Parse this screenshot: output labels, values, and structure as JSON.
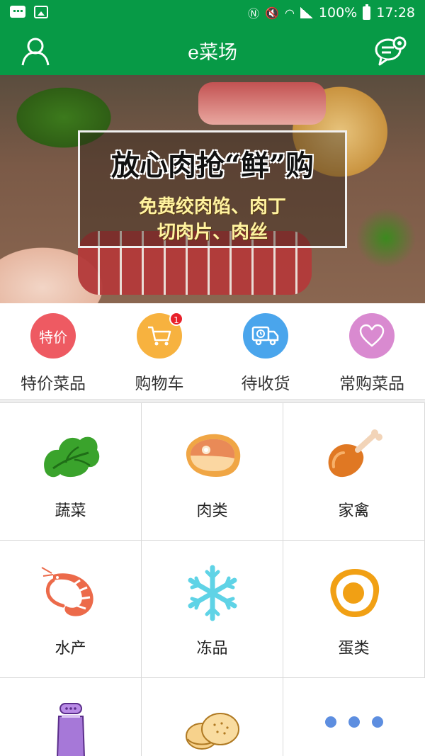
{
  "status_bar": {
    "battery": "100%",
    "time": "17:28",
    "icons": [
      "message-icon",
      "image-icon",
      "nfc-icon",
      "mute-icon",
      "wifi-icon",
      "signal-icon",
      "battery-icon"
    ]
  },
  "header": {
    "title": "e菜场",
    "left_icon": "user-icon",
    "right_icon": "chat-icon",
    "color": "#079a46"
  },
  "banner": {
    "headline": "放心肉抢“鲜”购",
    "line1": "免费绞肉馅、肉丁",
    "line2": "切肉片、肉丝",
    "page_count": 3,
    "active_page": 1
  },
  "quick_entries": [
    {
      "label": "特价菜品",
      "icon_text": "特价",
      "icon": "special-price-icon",
      "color": "#ee5a62"
    },
    {
      "label": "购物车",
      "icon": "cart-icon",
      "color": "#f7b23f",
      "badge": "1"
    },
    {
      "label": "待收货",
      "icon": "delivery-truck-icon",
      "color": "#4aa5ec"
    },
    {
      "label": "常购菜品",
      "icon": "heart-icon",
      "color": "#d98ad0"
    }
  ],
  "categories": [
    {
      "name": "蔬菜",
      "icon": "vegetable-icon"
    },
    {
      "name": "肉类",
      "icon": "meat-icon"
    },
    {
      "name": "家禽",
      "icon": "poultry-leg-icon"
    },
    {
      "name": "水产",
      "icon": "shrimp-icon"
    },
    {
      "name": "冻品",
      "icon": "snowflake-icon"
    },
    {
      "name": "蛋类",
      "icon": "egg-icon"
    },
    {
      "name": "",
      "icon": "seasoning-bottle-icon"
    },
    {
      "name": "",
      "icon": "biscuit-icon"
    },
    {
      "name": "",
      "icon": "more-icon"
    }
  ]
}
